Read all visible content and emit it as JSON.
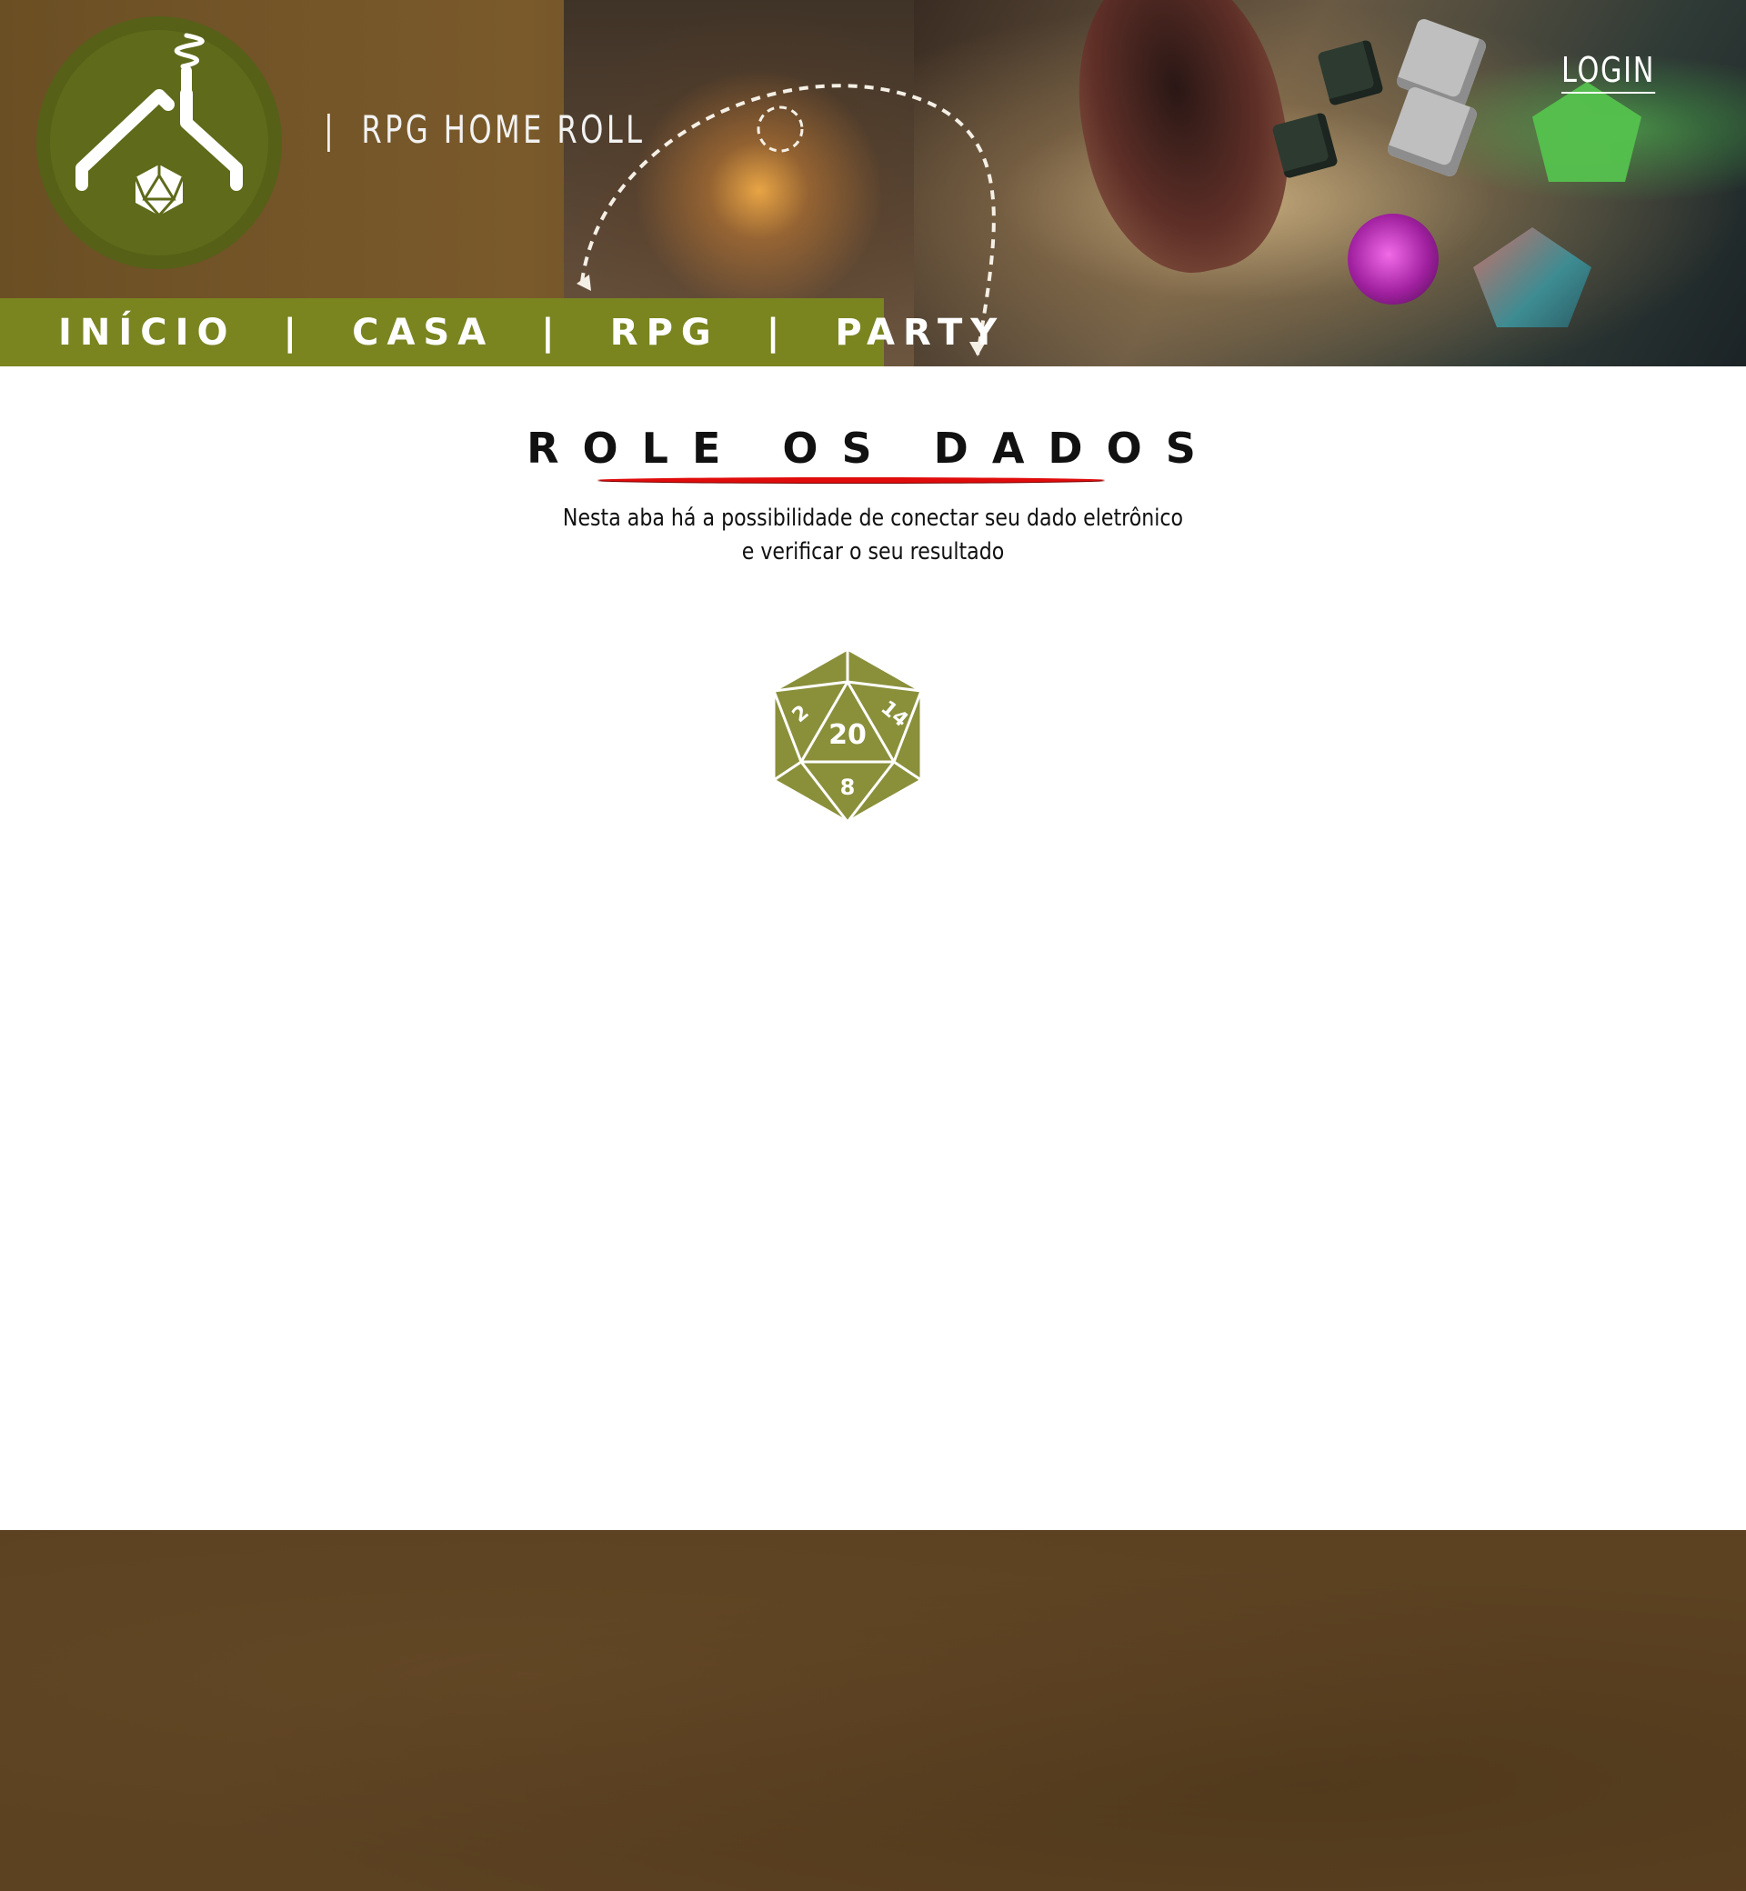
{
  "header": {
    "site_title": "|  RPG HOME ROLL",
    "login_label": "LOGIN",
    "nav": {
      "items": [
        {
          "label": "INÍCIO"
        },
        {
          "label": "CASA"
        },
        {
          "label": "RPG"
        },
        {
          "label": "PARTY"
        }
      ],
      "separator": "|"
    }
  },
  "main": {
    "title": "ROLE OS DADOS",
    "subtitle_line1": "Nesta aba há a possibilidade de conectar seu dado eletrônico",
    "subtitle_line2": "e verificar o seu resultado",
    "die": {
      "top_value": "20",
      "left_value": "2",
      "right_value": "14",
      "bottom_value": "8",
      "color": "#8a8f3a"
    }
  },
  "colors": {
    "nav_background": "#7a8520",
    "logo_background": "#566017",
    "title_underline": "#e00b0b",
    "footer_background": "#5c4221"
  }
}
